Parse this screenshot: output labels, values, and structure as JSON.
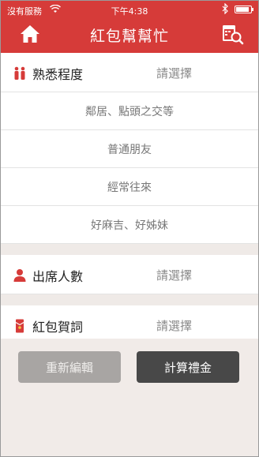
{
  "status_bar": {
    "carrier": "沒有服務",
    "time": "下午4:38"
  },
  "nav": {
    "title": "紅包幫幫忙",
    "home_icon": "home-icon",
    "tool_icon": "calendar-search-icon"
  },
  "familiarity": {
    "label": "熟悉程度",
    "value": "請選擇",
    "icon": "people-icon",
    "options": [
      "鄰居、點頭之交等",
      "普通朋友",
      "經常往來",
      "好麻吉、好姊妹"
    ]
  },
  "attendees": {
    "label": "出席人數",
    "value": "請選擇",
    "icon": "person-icon"
  },
  "greeting": {
    "label": "紅包賀詞",
    "value": "請選擇",
    "icon": "red-envelope-icon"
  },
  "buttons": {
    "reset": "重新編輯",
    "calculate": "計算禮金"
  },
  "colors": {
    "accent": "#d63b39",
    "dark_button": "#484848",
    "disabled_button": "#a8a5a3"
  }
}
